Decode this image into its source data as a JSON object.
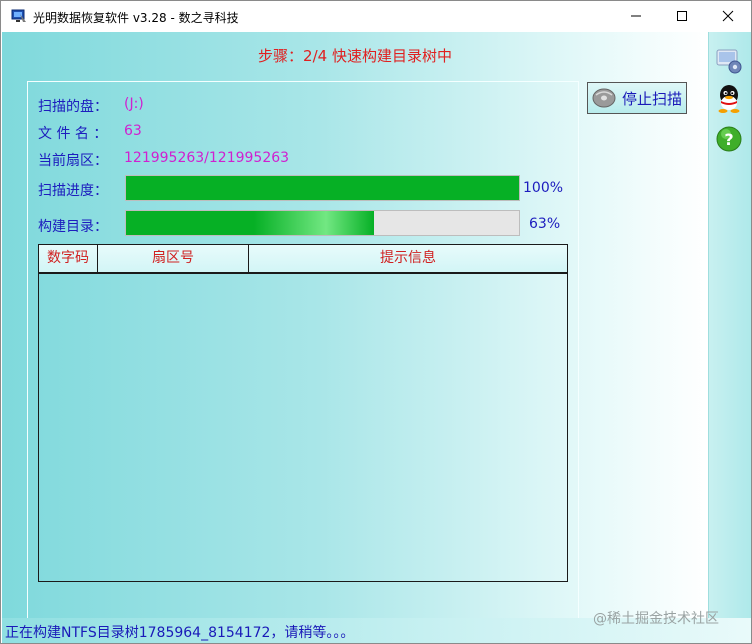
{
  "window": {
    "title": "光明数据恢复软件 v3.28 - 数之寻科技",
    "minimize_icon": "minimize-icon",
    "maximize_icon": "maximize-icon",
    "close_icon": "close-icon"
  },
  "step_title": "步骤：2/4 快速构建目录树中",
  "info": {
    "disk_label": "扫描的盘：",
    "disk_value": "(J:)",
    "filename_label": "文 件 名 ：",
    "filename_value": "63",
    "sector_label": "当前扇区：",
    "sector_value": "121995263/121995263"
  },
  "progress": {
    "scan_label": "扫描进度：",
    "scan_percent": 100,
    "scan_text": "100%",
    "build_label": "构建目录：",
    "build_percent": 63,
    "build_text": "63%"
  },
  "table": {
    "columns": [
      "数字码",
      "扇区号",
      "提示信息"
    ],
    "rows": []
  },
  "stop_button": {
    "label": "停止扫描",
    "icon": "disc-icon"
  },
  "side_icons": [
    "settings-icon",
    "qq-icon",
    "help-icon"
  ],
  "status": "正在构建NTFS目录树1785964_8154172，请稍等。。。",
  "watermark": "@稀土掘金技术社区",
  "colors": {
    "progress_fill": "#06b025",
    "label_text": "#1d1dbe",
    "value_text": "#d020d0",
    "title_text": "#e02020"
  }
}
